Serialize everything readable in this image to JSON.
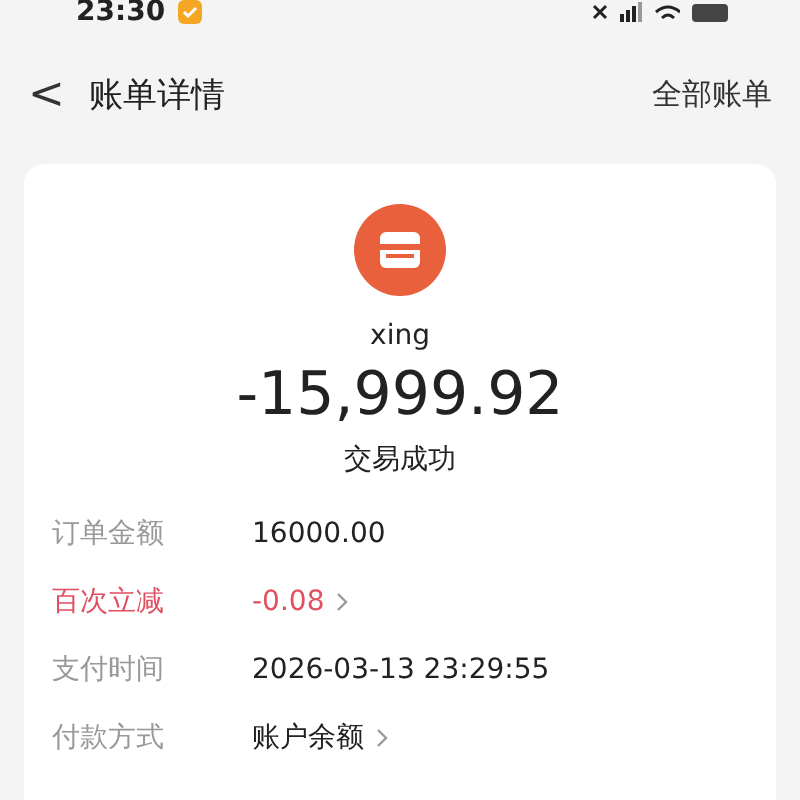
{
  "status_bar": {
    "time": "23:30"
  },
  "header": {
    "back": "<",
    "title": "账单详情",
    "action": "全部账单"
  },
  "merchant": {
    "name": "xing",
    "amount": "-15,999.92",
    "status": "交易成功"
  },
  "details": [
    {
      "label": "订单金额",
      "value": "16000.00",
      "highlight": false,
      "link": false
    },
    {
      "label": "百次立减",
      "value": "-0.08",
      "highlight": true,
      "link": true
    },
    {
      "label": "支付时间",
      "value": "2026-03-13 23:29:55",
      "highlight": false,
      "link": false
    },
    {
      "label": "付款方式",
      "value": "账户余额",
      "highlight": false,
      "link": true
    }
  ]
}
